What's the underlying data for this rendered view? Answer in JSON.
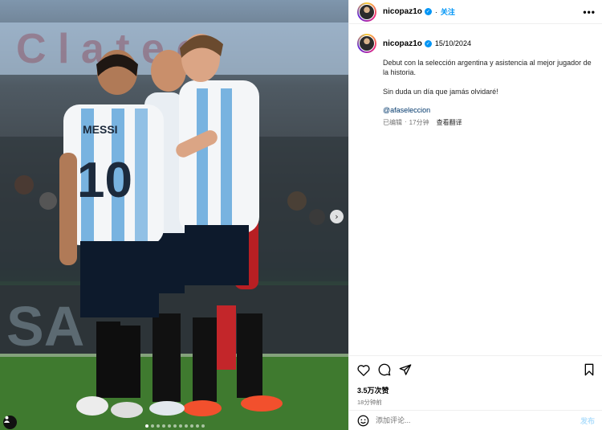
{
  "post": {
    "username": "nicopaz1o",
    "verified": true,
    "follow_label": "关注",
    "more_label": "•••",
    "date": "15/10/2024",
    "caption_line1": "Debut con la selección argentina y asistencia al mejor jugador de la historia.",
    "caption_line2": "Sin duda un día que jamás olvidaré!",
    "mention": "@afaseleccion",
    "edited_label": "已编辑",
    "meta_sep": "·",
    "edited_ago": "17分钟",
    "see_translation": "查看翻译",
    "likes": "3.5万次赞",
    "posted_ago": "18分钟前"
  },
  "comment": {
    "placeholder": "添加评论...",
    "post_label": "发布"
  },
  "photo": {
    "jersey_name": "MESSI",
    "jersey_number": "10",
    "ad_text": "SA",
    "carousel_total": 11,
    "carousel_active": 1
  },
  "icons": [
    "heart-icon",
    "comment-icon",
    "share-icon",
    "bookmark-icon",
    "emoji-icon",
    "user-tag-icon",
    "chevron-right-icon"
  ],
  "colors": {
    "accent": "#0095f6",
    "link": "#00376b"
  }
}
